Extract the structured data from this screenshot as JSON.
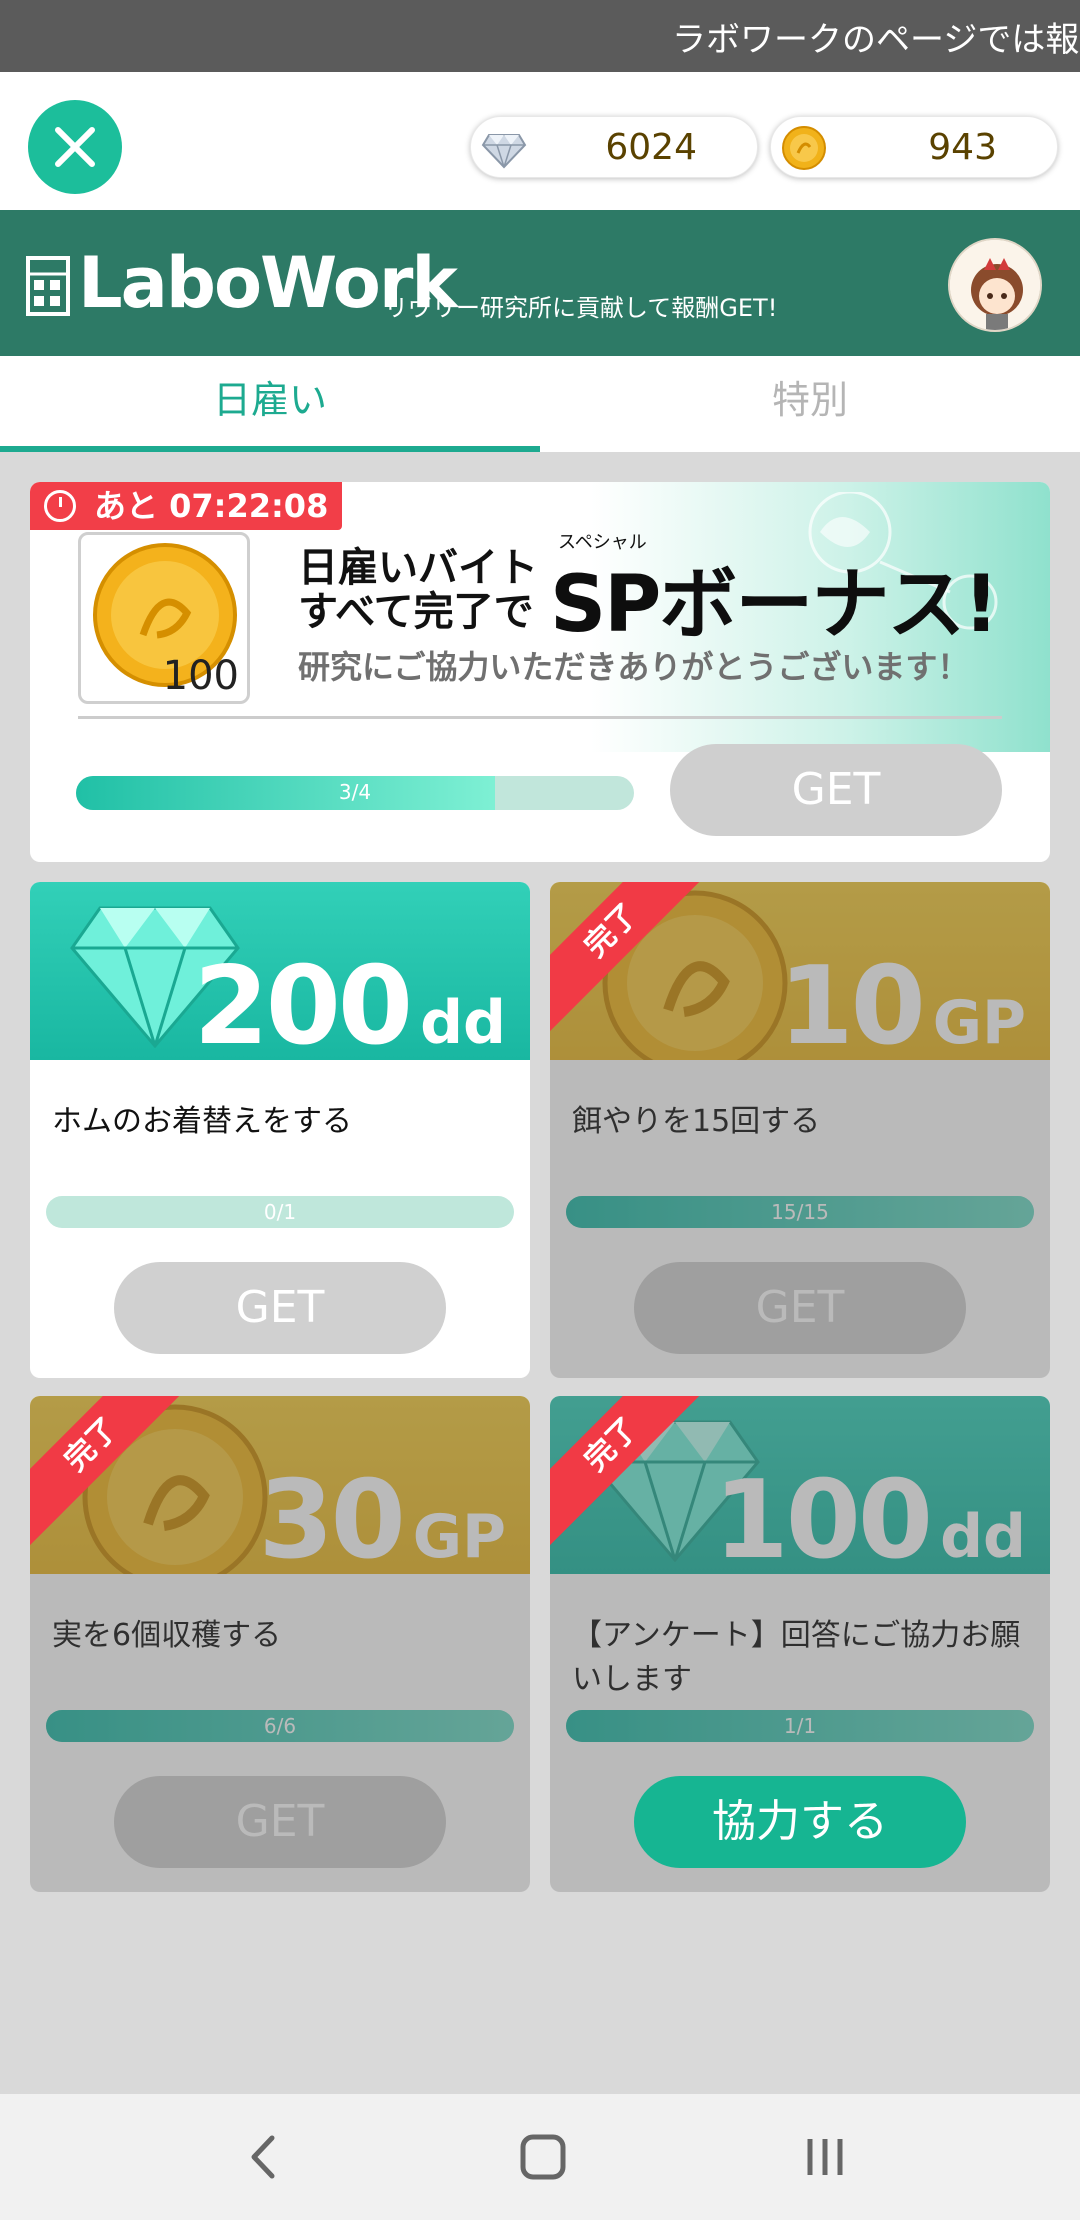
{
  "status_bar": {
    "ticker": "ラボワークのページでは報"
  },
  "currency": {
    "dd": "6024",
    "gp": "943"
  },
  "header": {
    "logo": "LaboWork",
    "tagline": "リヴリー研究所に貢献して報酬GET!"
  },
  "tabs": {
    "daily": "日雇い",
    "special": "特別"
  },
  "bonus": {
    "timer": "あと 07:22:08",
    "coin_qty": "100",
    "line1": "日雇いバイト",
    "line2": "すべて完了で",
    "ruby": "スペシャル",
    "headline": "SPボーナス!",
    "thanks": "研究にご協力いただきありがとうございます！",
    "progress_text": "3/4",
    "progress_fraction": 0.75,
    "button": "GET"
  },
  "tasks": [
    {
      "amount": "200",
      "unit": "dd",
      "label": "ホムのお着替えをする",
      "progress_text": "0/1",
      "progress_fraction": 0,
      "button": "GET",
      "completed": false
    },
    {
      "amount": "10",
      "unit": "GP",
      "label": "餌やりを15回する",
      "progress_text": "15/15",
      "progress_fraction": 1,
      "button": "GET",
      "completed": true,
      "badge": "完了"
    },
    {
      "amount": "30",
      "unit": "GP",
      "label": "実を6個収穫する",
      "progress_text": "6/6",
      "progress_fraction": 1,
      "button": "GET",
      "completed": true,
      "badge": "完了"
    },
    {
      "amount": "100",
      "unit": "dd",
      "label": "【アンケート】回答にご協力お願いします",
      "progress_text": "1/1",
      "progress_fraction": 1,
      "button": "協力する",
      "completed": true,
      "badge": "完了"
    }
  ],
  "colors": {
    "accent": "#1cbe9b",
    "header": "#2d7a66",
    "badge": "#f13a45"
  },
  "icons": [
    "close-icon",
    "diamond-icon",
    "coin-icon",
    "calculator-icon",
    "clock-icon",
    "back-icon",
    "home-icon",
    "recents-icon"
  ]
}
